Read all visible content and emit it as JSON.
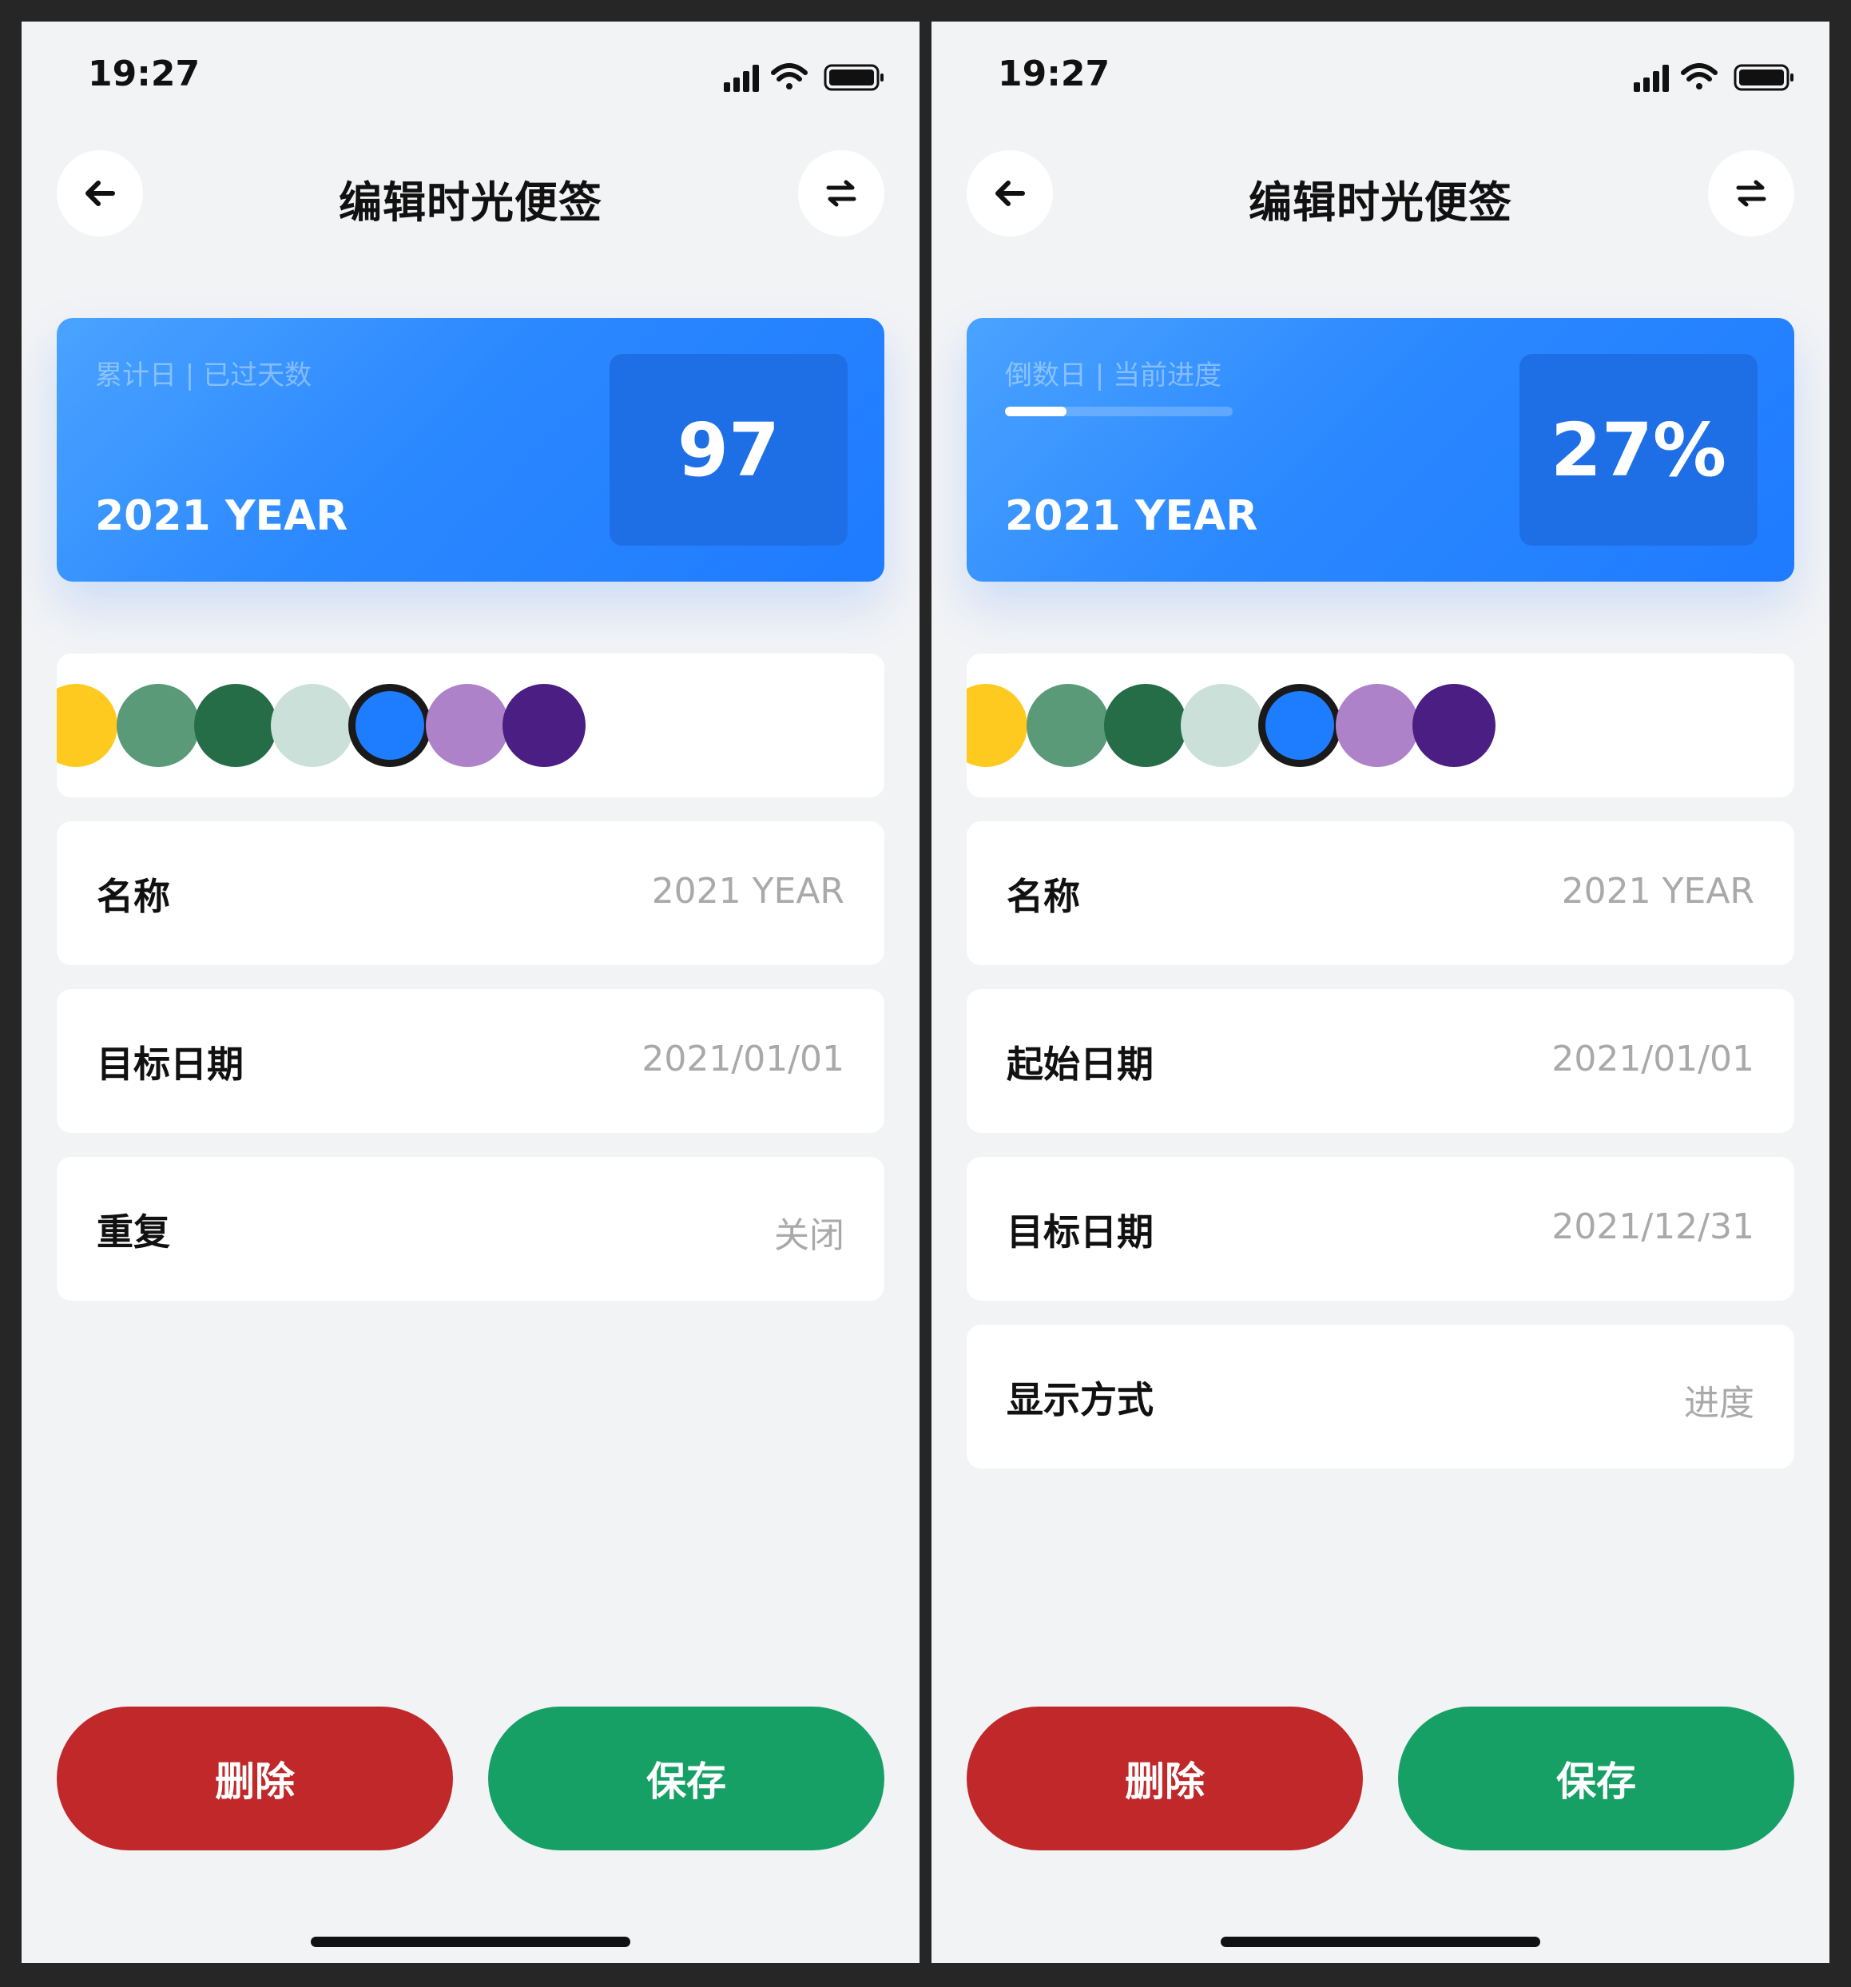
{
  "screens": [
    {
      "status_time": "19:27",
      "title": "编辑时光便签",
      "card": {
        "label": "累计日 | 已过天数",
        "year": "2021 YEAR",
        "value": "97"
      },
      "colors": [
        "#ffca1f",
        "#5b9a78",
        "#256d47",
        "#cce0da",
        "#1e7cff",
        "#ad82c9",
        "#4b1e83"
      ],
      "selected_color_index": 4,
      "fields": [
        {
          "label": "名称",
          "value": "2021 YEAR"
        },
        {
          "label": "目标日期",
          "value": "2021/01/01"
        },
        {
          "label": "重复",
          "value": "关闭"
        }
      ],
      "delete_label": "删除",
      "save_label": "保存"
    },
    {
      "status_time": "19:27",
      "title": "编辑时光便签",
      "card": {
        "label": "倒数日 | 当前进度",
        "year": "2021 YEAR",
        "value": "27%",
        "progress": 0.27
      },
      "colors": [
        "#ffca1f",
        "#5b9a78",
        "#256d47",
        "#cce0da",
        "#1e7cff",
        "#ad82c9",
        "#4b1e83"
      ],
      "selected_color_index": 4,
      "fields": [
        {
          "label": "名称",
          "value": "2021 YEAR"
        },
        {
          "label": "起始日期",
          "value": "2021/01/01"
        },
        {
          "label": "目标日期",
          "value": "2021/12/31"
        },
        {
          "label": "显示方式",
          "value": "进度"
        }
      ],
      "delete_label": "删除",
      "save_label": "保存"
    }
  ],
  "icons": {
    "back": "arrow-left-icon",
    "swap": "swap-icon",
    "signal": "cellular-signal-icon",
    "wifi": "wifi-icon",
    "battery": "battery-icon"
  }
}
